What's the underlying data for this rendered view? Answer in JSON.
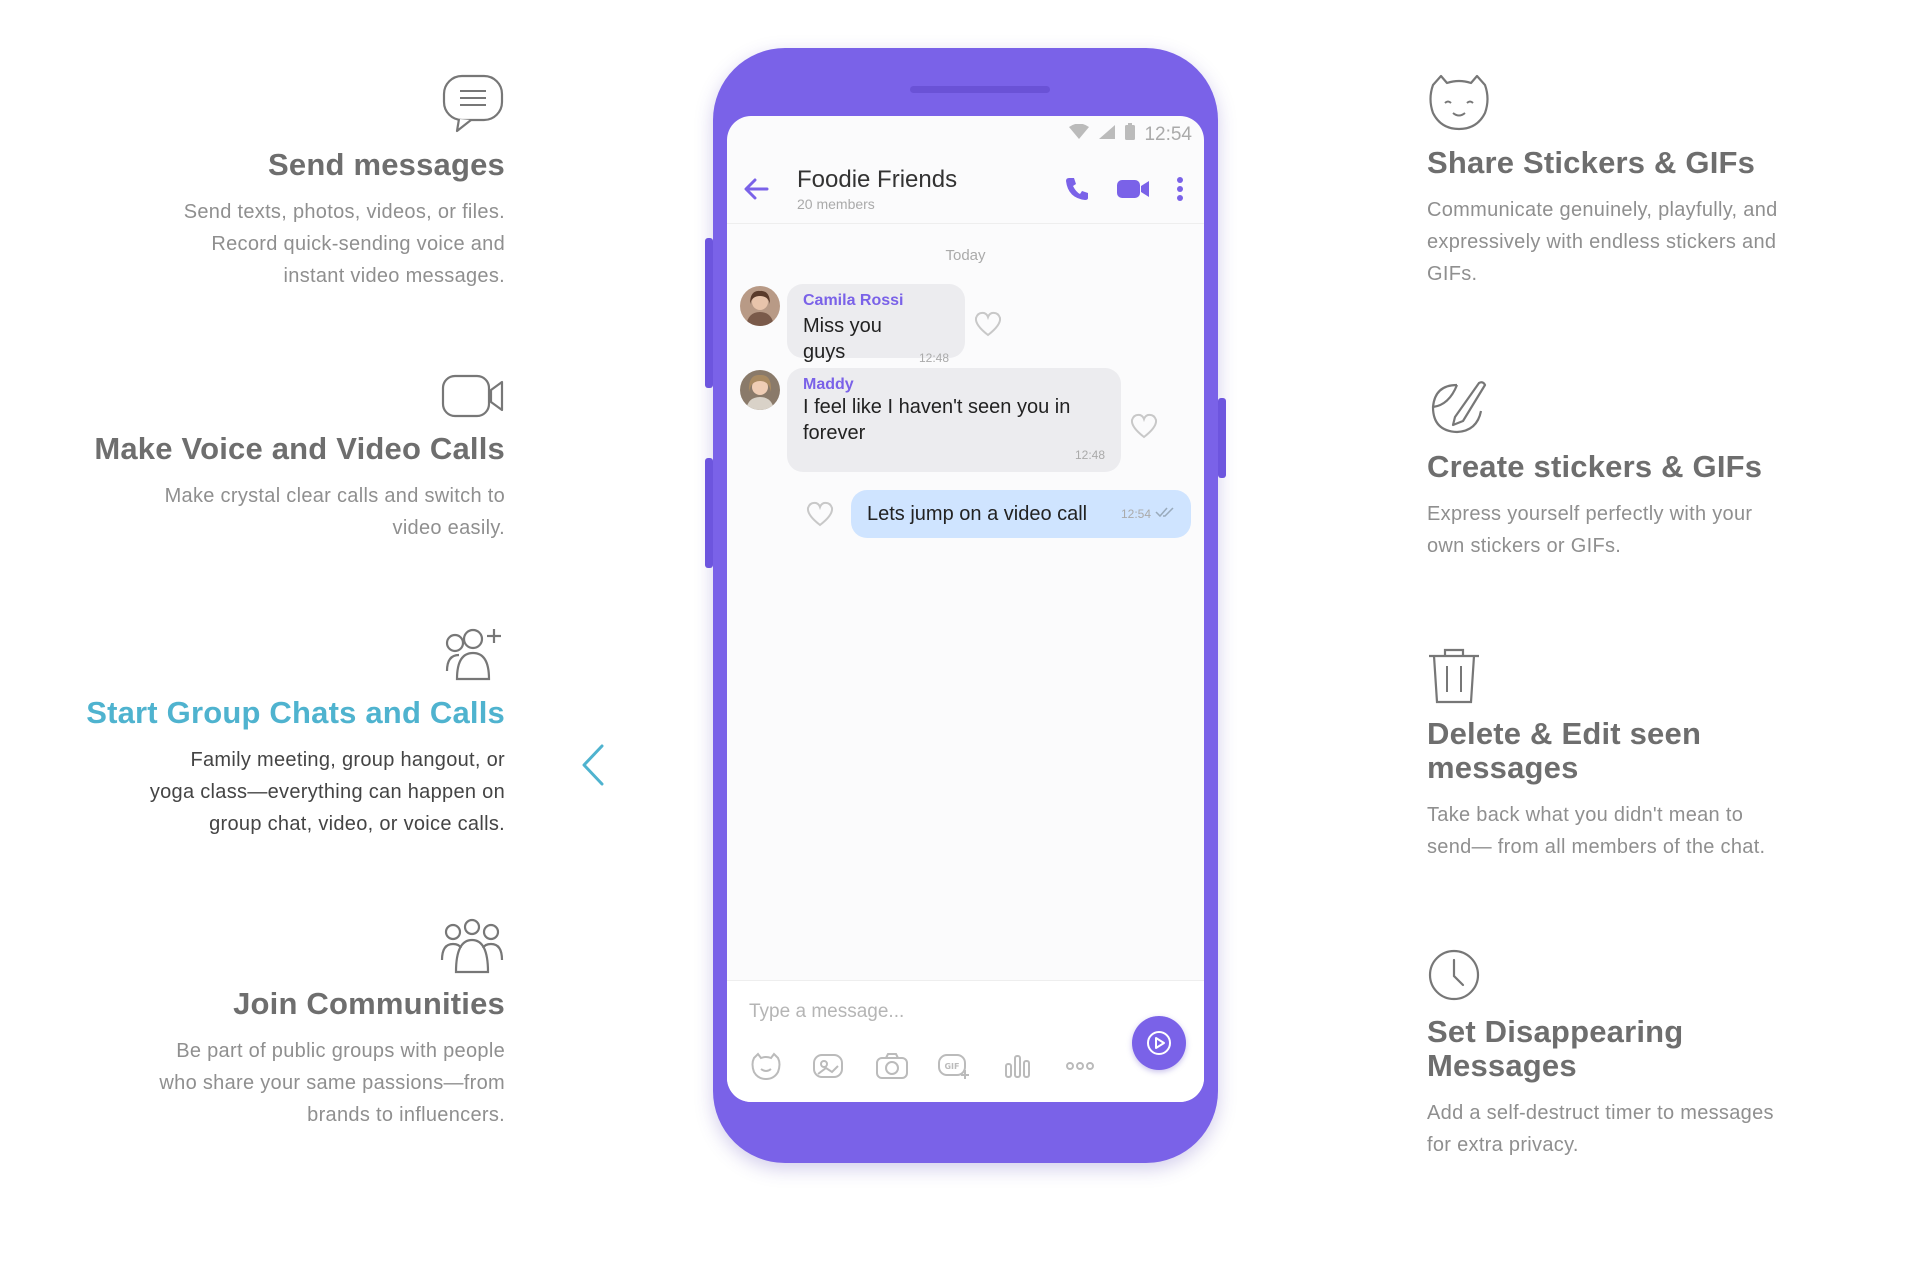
{
  "left_features": [
    {
      "title": "Send messages",
      "desc_lines": [
        "Send texts, photos, videos, or files.",
        "Record quick-sending voice and",
        "instant video messages."
      ]
    },
    {
      "title": "Make Voice and Video Calls",
      "desc_lines": [
        "Make crystal clear calls and switch to",
        "video easily."
      ]
    },
    {
      "title": "Start Group Chats and Calls",
      "desc_lines": [
        "Family meeting, group hangout, or",
        "yoga class—everything can happen on",
        "group chat, video, or voice calls."
      ]
    },
    {
      "title": "Join Communities",
      "desc_lines": [
        "Be part of public groups with people",
        "who share your same passions—from",
        "brands to influencers."
      ]
    }
  ],
  "right_features": [
    {
      "title": "Share Stickers & GIFs",
      "desc_lines": [
        "Communicate genuinely, playfully, and",
        "expressively with endless stickers and",
        "GIFs."
      ]
    },
    {
      "title": "Create stickers & GIFs",
      "desc_lines": [
        "Express yourself perfectly with your",
        "own stickers or GIFs."
      ]
    },
    {
      "title": "Delete & Edit seen messages",
      "desc_lines": [
        "Take back what you didn't mean to",
        "send— from all members of the chat."
      ]
    },
    {
      "title": "Set Disappearing Messages",
      "desc_lines": [
        "Add a self-destruct timer to messages",
        "for extra privacy."
      ]
    }
  ],
  "phone": {
    "status_time": "12:54",
    "chat": {
      "name": "Foodie Friends",
      "members": "20 members"
    },
    "day_label": "Today",
    "messages": [
      {
        "sender": "Camila Rossi",
        "text": "Miss you guys",
        "time": "12:48"
      },
      {
        "sender": "Maddy",
        "text_lines": [
          "I feel like I haven't seen you in",
          "forever"
        ],
        "time": "12:48"
      },
      {
        "text": "Lets jump on a video call",
        "time": "12:54"
      }
    ],
    "composer_placeholder": "Type a message..."
  },
  "colors": {
    "accent": "#7a62e8",
    "active_feature": "#4fb3cf",
    "outgoing_bubble": "#cfe4ff"
  }
}
